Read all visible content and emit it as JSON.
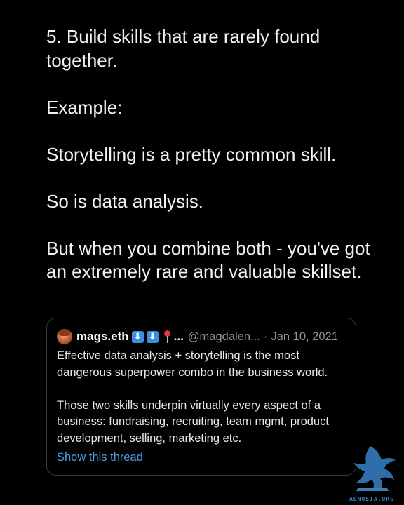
{
  "main": {
    "paragraphs": [
      "5. Build skills that are rarely found together.",
      "Example:",
      "Storytelling is a pretty common skill.",
      "So is data analysis.",
      "But when you combine both - you've got an extremely rare and valuable skillset."
    ]
  },
  "quote": {
    "author_name": "mags.eth",
    "emoji_1": "⬇",
    "emoji_2": "⬇",
    "ellipsis": "...",
    "handle": "@magdalen...",
    "separator": "·",
    "date": "Jan 10, 2021",
    "body_1": "Effective data analysis + storytelling is the most dangerous superpower combo in the business world.",
    "body_2": "Those two skills underpin virtually every aspect of a business: fundraising, recruiting, team mgmt, product development, selling, marketing etc.",
    "show_thread": "Show this thread"
  },
  "watermark": {
    "text": "ABNOSIA.ORG"
  },
  "colors": {
    "background": "#000000",
    "text": "#f2f2f2",
    "muted": "#8b949e",
    "link": "#4a9fe8",
    "card_border": "#3a3a3a",
    "emoji_blue": "#3b8fe0"
  }
}
